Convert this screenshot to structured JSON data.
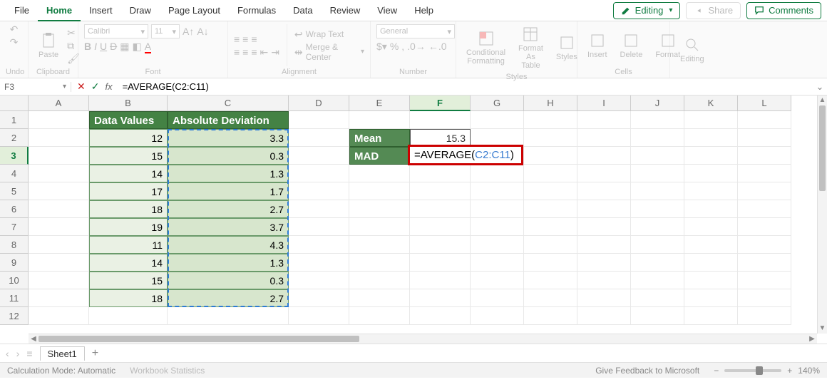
{
  "tabs": [
    "File",
    "Home",
    "Insert",
    "Draw",
    "Page Layout",
    "Formulas",
    "Data",
    "Review",
    "View",
    "Help"
  ],
  "active_tab": "Home",
  "top_right": {
    "editing": "Editing",
    "share": "Share",
    "comments": "Comments"
  },
  "ribbon": {
    "undo": "Undo",
    "paste": "Paste",
    "clipboard": "Clipboard",
    "font_name": "Calibri",
    "font_size": "11",
    "font": "Font",
    "wrap": "Wrap Text",
    "merge": "Merge & Center",
    "alignment": "Alignment",
    "number_format": "General",
    "number": "Number",
    "cond_fmt": "Conditional Formatting",
    "fmt_as_table": "Format As Table",
    "styles_btn": "Styles",
    "styles": "Styles",
    "insert": "Insert",
    "delete": "Delete",
    "format": "Format",
    "cells": "Cells",
    "editing_grp": "Editing"
  },
  "name_box": "F3",
  "formula_bar": "=AVERAGE(C2:C11)",
  "columns": [
    "A",
    "B",
    "C",
    "D",
    "E",
    "F",
    "G",
    "H",
    "I",
    "J",
    "K",
    "L"
  ],
  "rows": [
    "1",
    "2",
    "3",
    "4",
    "5",
    "6",
    "7",
    "8",
    "9",
    "10",
    "11",
    "12"
  ],
  "selected_col": "F",
  "selected_row": "3",
  "headers": {
    "b": "Data Values",
    "c": "Absolute Deviation"
  },
  "data_b": [
    "12",
    "15",
    "14",
    "17",
    "18",
    "19",
    "11",
    "14",
    "15",
    "18"
  ],
  "data_c": [
    "3.3",
    "0.3",
    "1.3",
    "1.7",
    "2.7",
    "3.7",
    "4.3",
    "1.3",
    "0.3",
    "2.7"
  ],
  "side": {
    "mean_label": "Mean",
    "mean_val": "15.3",
    "mad_label": "MAD"
  },
  "formula_cell": {
    "prefix": "=AVERAGE(",
    "ref": "C2:C11",
    "suffix": ")"
  },
  "sheet": {
    "name": "Sheet1"
  },
  "status": {
    "calc": "Calculation Mode: Automatic",
    "wbstats": "Workbook Statistics",
    "feedback": "Give Feedback to Microsoft",
    "zoom": "140%"
  },
  "chart_data": {
    "type": "table",
    "title": "Mean Absolute Deviation example",
    "columns": [
      "Data Values",
      "Absolute Deviation"
    ],
    "rows": [
      [
        12,
        3.3
      ],
      [
        15,
        0.3
      ],
      [
        14,
        1.3
      ],
      [
        17,
        1.7
      ],
      [
        18,
        2.7
      ],
      [
        19,
        3.7
      ],
      [
        11,
        4.3
      ],
      [
        14,
        1.3
      ],
      [
        15,
        0.3
      ],
      [
        18,
        2.7
      ]
    ],
    "summary": {
      "Mean": 15.3,
      "MAD_formula": "=AVERAGE(C2:C11)"
    }
  }
}
